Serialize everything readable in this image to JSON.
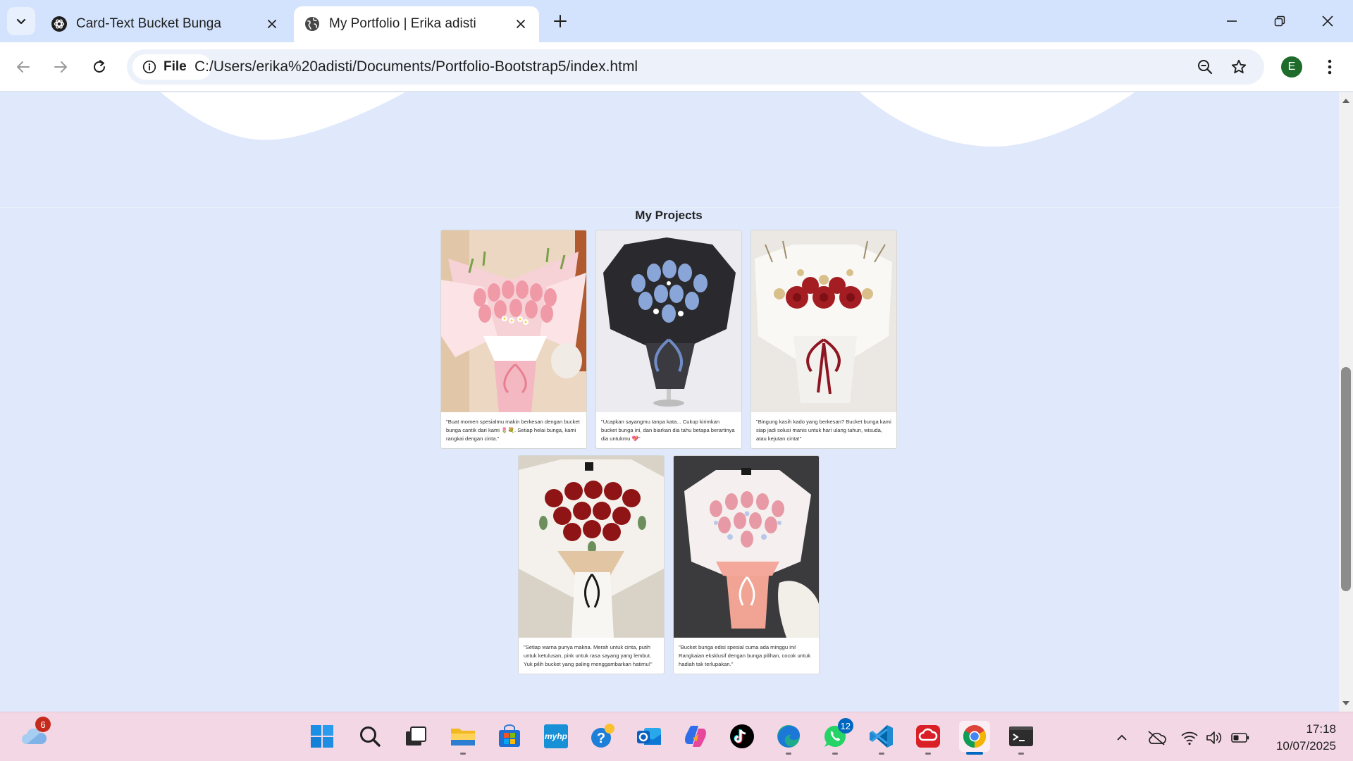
{
  "browser": {
    "tabs": [
      {
        "title": "Card-Text Bucket Bunga",
        "active": false,
        "favicon": "openai-icon"
      },
      {
        "title": "My Portfolio | Erika adisti",
        "active": true,
        "favicon": "globe-icon"
      }
    ],
    "address": {
      "chip_label": "File",
      "url": "C:/Users/erika%20adisti/Documents/Portfolio-Bootstrap5/index.html"
    },
    "profile_initial": "E"
  },
  "page": {
    "section_title": "My Projects",
    "projects": [
      {
        "caption": "\"Buat momen spesialmu makin berkesan dengan bucket bunga cantik dari kami 🌷💐. Setiap helai bunga, kami rangkai dengan cinta.\"",
        "image": "pink tulip bouquet"
      },
      {
        "caption": "\"Ucapkan sayangmu tanpa kata... Cukup kirimkan bucket bunga ini, dan biarkan dia tahu betapa berartinya dia untukmu 💖\"",
        "image": "blue tulip bouquet with black wrap"
      },
      {
        "caption": "\"Bingung kasih kado yang berkesan? Bucket bunga kami siap jadi solusi manis untuk hari ulang tahun, wisuda, atau kejutan cinta!\"",
        "image": "red rose bouquet with white wrap"
      },
      {
        "caption": "\"Setiap warna punya makna. Merah untuk cinta, putih untuk ketulusan, pink untuk rasa sayang yang lembut. Yuk pilih bucket yang paling menggambarkan hatimu!\"",
        "image": "red rose bouquet with cream wrap"
      },
      {
        "caption": "\"Bucket bunga edisi spesial cuma ada minggu ini! Rangkaian eksklusif dengan bunga pilihan, cocok untuk hadiah tak terlupakan.\"",
        "image": "pink tulip bouquet on dark background"
      }
    ]
  },
  "taskbar": {
    "weather_badge": "6",
    "whatsapp_badge": "12",
    "apps": [
      "start-icon",
      "search-icon",
      "task-view-icon",
      "file-explorer-icon",
      "microsoft-store-icon",
      "myhp-icon",
      "help-icon",
      "outlook-icon",
      "copilot-icon",
      "tiktok-icon",
      "edge-icon",
      "whatsapp-icon",
      "vscode-icon",
      "creative-cloud-icon",
      "chrome-icon",
      "terminal-icon"
    ],
    "myhp_label": "myhp",
    "time": "17:18",
    "date": "10/07/2025"
  },
  "colors": {
    "page_bg": "#dfe9fb",
    "tabstrip_bg": "#d3e3fd",
    "taskbar_bg": "#f4d7e5",
    "badge_red": "#c42b1c",
    "badge_blue": "#0067c0"
  }
}
